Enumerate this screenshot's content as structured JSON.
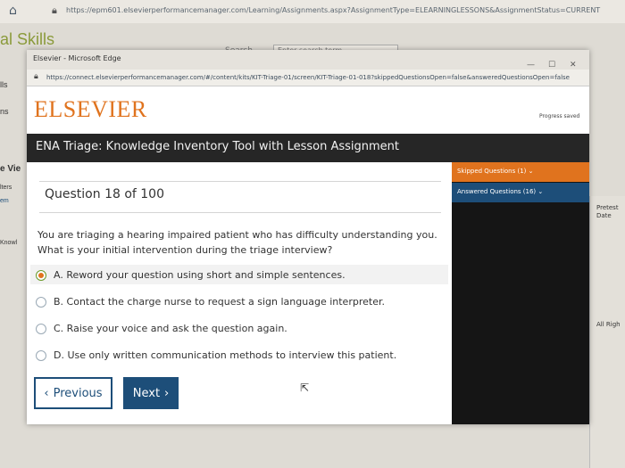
{
  "back_browser": {
    "url": "https://epm601.elsevierperformancemanager.com/Learning/Assignments.aspx?AssignmentType=ELEARNINGLESSONS&AssignmentStatus=CURRENT",
    "page_title": "al Skills",
    "search_label": "Search",
    "search_placeholder": "Enter search term...",
    "left_fragments": [
      "lls",
      "ns",
      "e Vie",
      "lters",
      "em",
      "Knowl"
    ],
    "right_fragments": [
      "Pretest Date",
      "All Righ"
    ]
  },
  "popup": {
    "window_title": "Elsevier - Microsoft Edge",
    "url": "https://connect.elsevierperformancemanager.com/#/content/kits/KIT-Triage-01/screen/KIT-Triage-01-018?skippedQuestionsOpen=false&answeredQuestionsOpen=false",
    "logo": "ELSEVIER",
    "progress_saved": "Progress saved",
    "course_title": "ENA Triage: Knowledge Inventory Tool with Lesson Assignment"
  },
  "question": {
    "number_label": "Question 18 of 100",
    "text": "You are triaging a hearing impaired patient who has difficulty understanding you. What is your initial intervention during the triage interview?",
    "options": [
      {
        "label": "A. Reword your question using short and simple sentences.",
        "selected": true
      },
      {
        "label": "B. Contact the charge nurse to request a sign language interpreter.",
        "selected": false
      },
      {
        "label": "C. Raise your voice and ask the question again.",
        "selected": false
      },
      {
        "label": "D. Use only written communication methods to interview this patient.",
        "selected": false
      }
    ]
  },
  "navigation": {
    "previous_label": "Previous",
    "next_label": "Next"
  },
  "sidebar": {
    "skipped_label": "Skipped Questions (1)",
    "answered_label": "Answered Questions (16)"
  },
  "colors": {
    "accent_orange": "#e0731e",
    "accent_blue": "#1d4e79",
    "header_dark": "#262626"
  },
  "icons": [
    "home-icon",
    "lock-icon",
    "chevron-down-icon",
    "chevron-left-icon",
    "chevron-right-icon",
    "minimize-icon",
    "maximize-icon",
    "close-icon",
    "mouse-cursor-icon"
  ]
}
